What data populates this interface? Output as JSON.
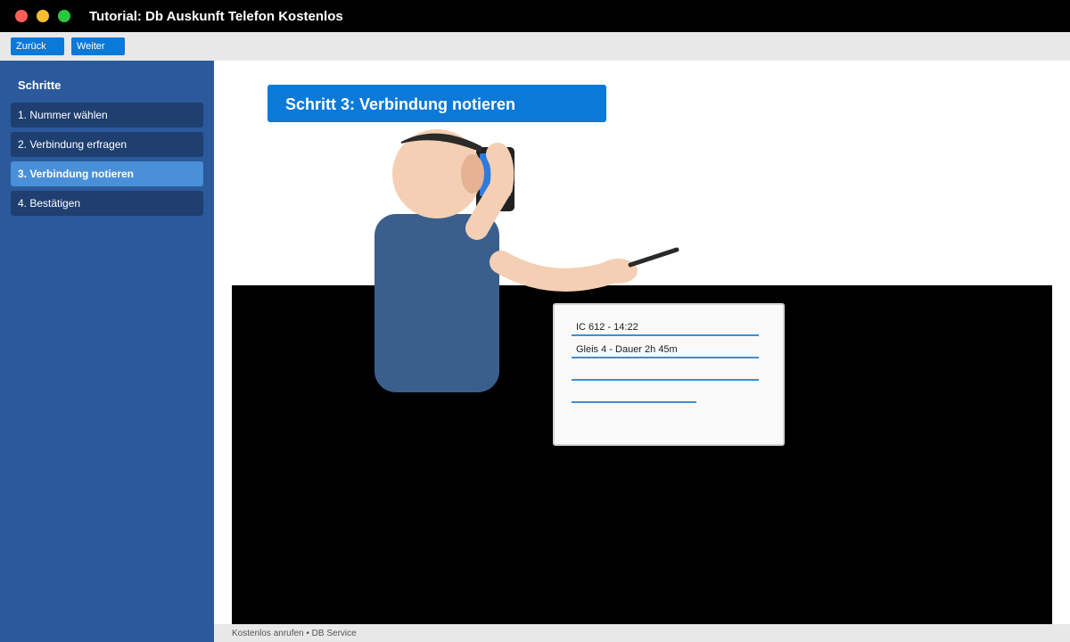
{
  "window": {
    "title": "Tutorial: Db Auskunft Telefon Kostenlos"
  },
  "toolbar": {
    "back_label": "Zurück",
    "next_label": "Weiter"
  },
  "sidebar": {
    "heading": "Schritte",
    "steps": [
      {
        "label": "1. Nummer wählen",
        "active": false
      },
      {
        "label": "2. Verbindung erfragen",
        "active": false
      },
      {
        "label": "3. Verbindung notieren",
        "active": true
      },
      {
        "label": "4. Bestätigen",
        "active": false
      }
    ]
  },
  "main": {
    "step_title": "Schritt 3: Verbindung notieren",
    "notepad": {
      "lines": [
        "IC 612 - 14:22",
        "Gleis 4 - Dauer 2h 45m",
        "",
        ""
      ]
    }
  },
  "footer": {
    "text": "Kostenlos anrufen • DB Service"
  },
  "colors": {
    "accent": "#0a79d8",
    "sidebar_bg": "#2b5a9c",
    "sidebar_item_bg": "#1f3f70",
    "sidebar_item_active": "#4a90d9",
    "note_line": "#3b8fd6"
  }
}
